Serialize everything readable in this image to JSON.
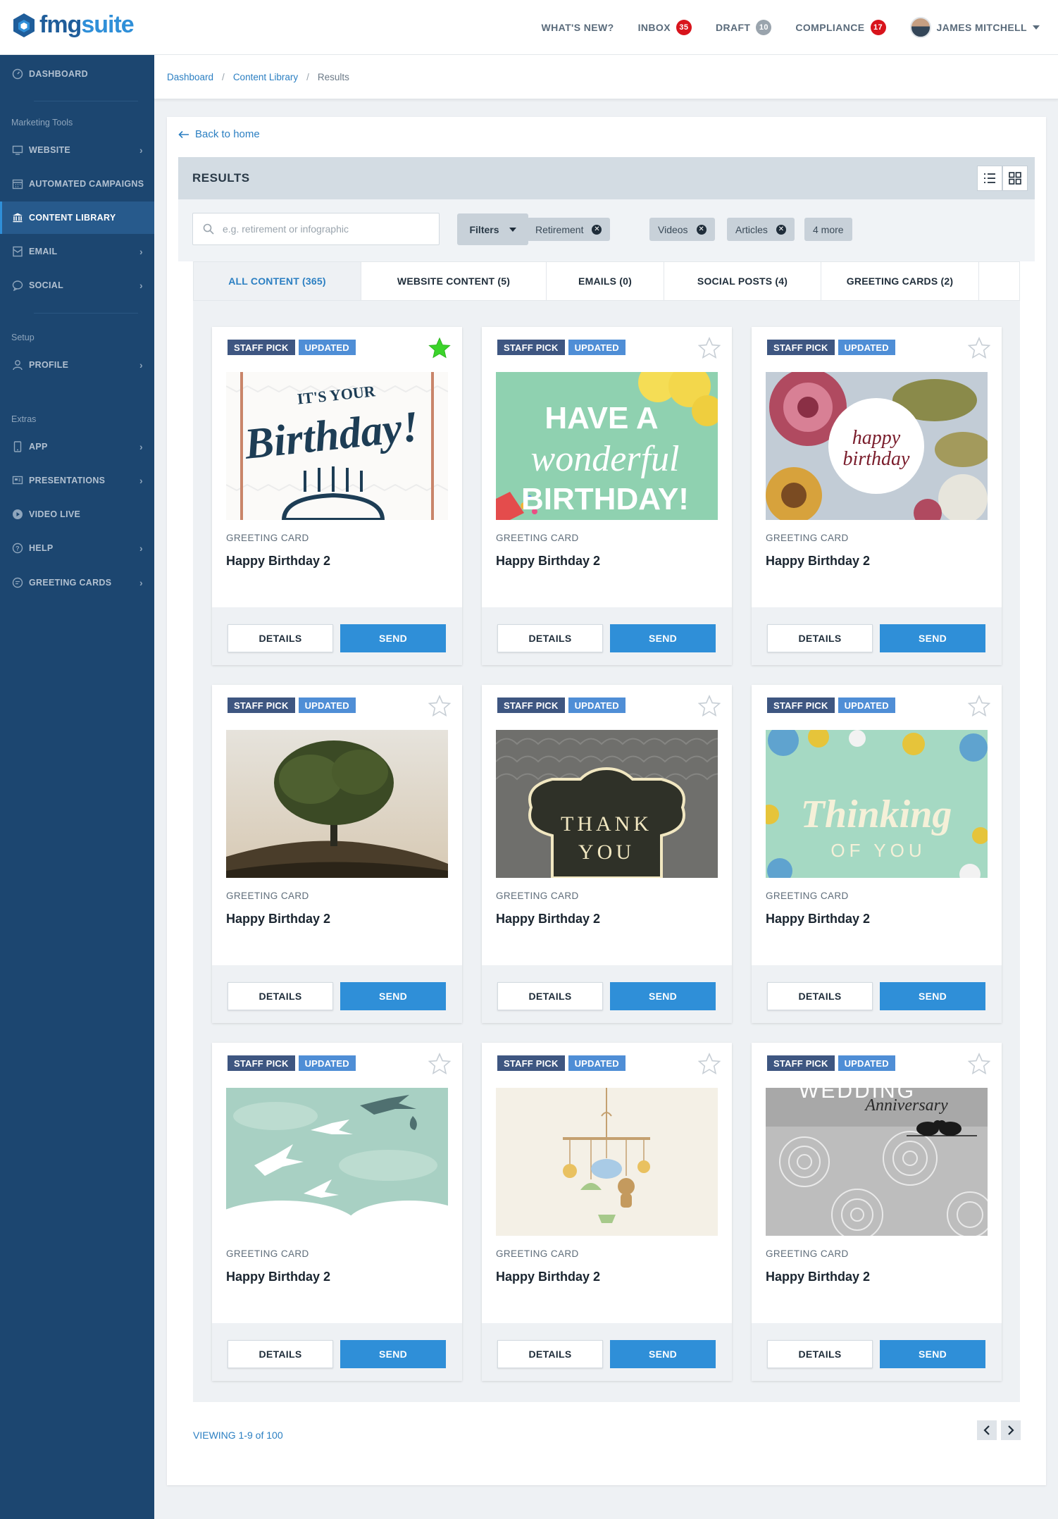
{
  "app": {
    "logo_prefix": "fmg",
    "logo_suffix": "suite"
  },
  "topnav": {
    "whats_new": "WHAT'S NEW?",
    "inbox": "INBOX",
    "inbox_count": "35",
    "draft": "DRAFT",
    "draft_count": "10",
    "compliance": "COMPLIANCE",
    "compliance_count": "17",
    "user": "JAMES MITCHELL"
  },
  "sidebar": {
    "dashboard": "DASHBOARD",
    "section_marketing": "Marketing Tools",
    "website": "WEBSITE",
    "automated": "AUTOMATED CAMPAIGNS",
    "content_library": "CONTENT LIBRARY",
    "email": "EMAIL",
    "social": "SOCIAL",
    "section_setup": "Setup",
    "profile": "PROFILE",
    "section_extras": "Extras",
    "app": "APP",
    "presentations": "PRESENTATIONS",
    "video_live": "VIDEO LIVE",
    "help": "HELP",
    "greeting_cards": "GREETING CARDS"
  },
  "breadcrumb": {
    "home": "Dashboard",
    "library": "Content Library",
    "current": "Results"
  },
  "back_label": "Back to home",
  "results_title": "RESULTS",
  "search": {
    "placeholder": "e.g. retirement or infographic"
  },
  "filters_label": "Filters",
  "chips": [
    "Retirement",
    "Videos",
    "Articles"
  ],
  "more_chip": "4 more",
  "tabs": [
    "ALL CONTENT (365)",
    "WEBSITE CONTENT (5)",
    "EMAILS (0)",
    "SOCIAL POSTS (4)",
    "GREETING CARDS (2)"
  ],
  "cards": [
    {
      "tag1": "STAFF PICK",
      "tag2": "UPDATED",
      "type": "GREETING CARD",
      "title": "Happy Birthday 2",
      "details": "DETAILS",
      "send": "SEND",
      "starred": true,
      "image_text": {
        "line1": "IT'S YOUR",
        "line2": "Birthday!"
      }
    },
    {
      "tag1": "STAFF PICK",
      "tag2": "UPDATED",
      "type": "GREETING CARD",
      "title": "Happy Birthday 2",
      "details": "DETAILS",
      "send": "SEND",
      "starred": false,
      "image_text": {
        "line1": "HAVE A",
        "line2": "wonderful",
        "line3": "BIRTHDAY!"
      }
    },
    {
      "tag1": "STAFF PICK",
      "tag2": "UPDATED",
      "type": "GREETING CARD",
      "title": "Happy Birthday 2",
      "details": "DETAILS",
      "send": "SEND",
      "starred": false,
      "image_text": {
        "line1": "happy",
        "line2": "birthday"
      }
    },
    {
      "tag1": "STAFF PICK",
      "tag2": "UPDATED",
      "type": "GREETING CARD",
      "title": "Happy Birthday 2",
      "details": "DETAILS",
      "send": "SEND",
      "starred": false
    },
    {
      "tag1": "STAFF PICK",
      "tag2": "UPDATED",
      "type": "GREETING CARD",
      "title": "Happy Birthday 2",
      "details": "DETAILS",
      "send": "SEND",
      "starred": false,
      "image_text": {
        "line1": "THANK",
        "line2": "YOU"
      }
    },
    {
      "tag1": "STAFF PICK",
      "tag2": "UPDATED",
      "type": "GREETING CARD",
      "title": "Happy Birthday 2",
      "details": "DETAILS",
      "send": "SEND",
      "starred": false,
      "image_text": {
        "line1": "Thinking",
        "line2": "OF YOU"
      }
    },
    {
      "tag1": "STAFF PICK",
      "tag2": "UPDATED",
      "type": "GREETING CARD",
      "title": "Happy Birthday 2",
      "details": "DETAILS",
      "send": "SEND",
      "starred": false
    },
    {
      "tag1": "STAFF PICK",
      "tag2": "UPDATED",
      "type": "GREETING CARD",
      "title": "Happy Birthday 2",
      "details": "DETAILS",
      "send": "SEND",
      "starred": false
    },
    {
      "tag1": "STAFF PICK",
      "tag2": "UPDATED",
      "type": "GREETING CARD",
      "title": "Happy Birthday 2",
      "details": "DETAILS",
      "send": "SEND",
      "starred": false,
      "image_text": {
        "line1": "WEDDING",
        "line2": "Anniversary"
      }
    }
  ],
  "viewing": "VIEWING 1-9 of 100",
  "colors": {
    "brand": "#1f5d9a",
    "accent": "#2f8fd8",
    "sidebar": "#1c4670",
    "badge": "#d8141c",
    "star_active": "#3bd42a"
  }
}
